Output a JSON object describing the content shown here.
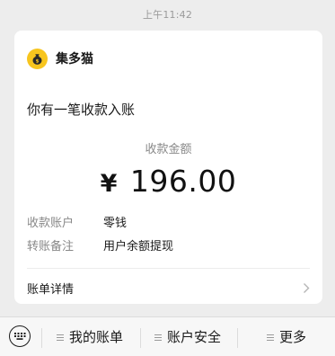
{
  "timestamp": "上午11:42",
  "app": {
    "name": "集多猫"
  },
  "message": {
    "title": "你有一笔收款入账",
    "amount_label": "收款金额",
    "currency": "¥",
    "amount": "196.00",
    "rows": [
      {
        "key": "收款账户",
        "value": "零钱"
      },
      {
        "key": "转账备注",
        "value": "用户余额提现"
      }
    ],
    "detail_link": "账单详情"
  },
  "menu": {
    "items": [
      {
        "label": "我的账单"
      },
      {
        "label": "账户安全"
      },
      {
        "label": "更多"
      }
    ]
  },
  "colors": {
    "logo": "#f7c51e",
    "background": "#ededed",
    "card": "#ffffff",
    "muted_text": "#888888"
  },
  "icons": {
    "logo": "money-bag-icon",
    "chevron": "chevron-right-icon",
    "keyboard": "keyboard-icon",
    "menu_lines": "menu-lines-icon"
  }
}
